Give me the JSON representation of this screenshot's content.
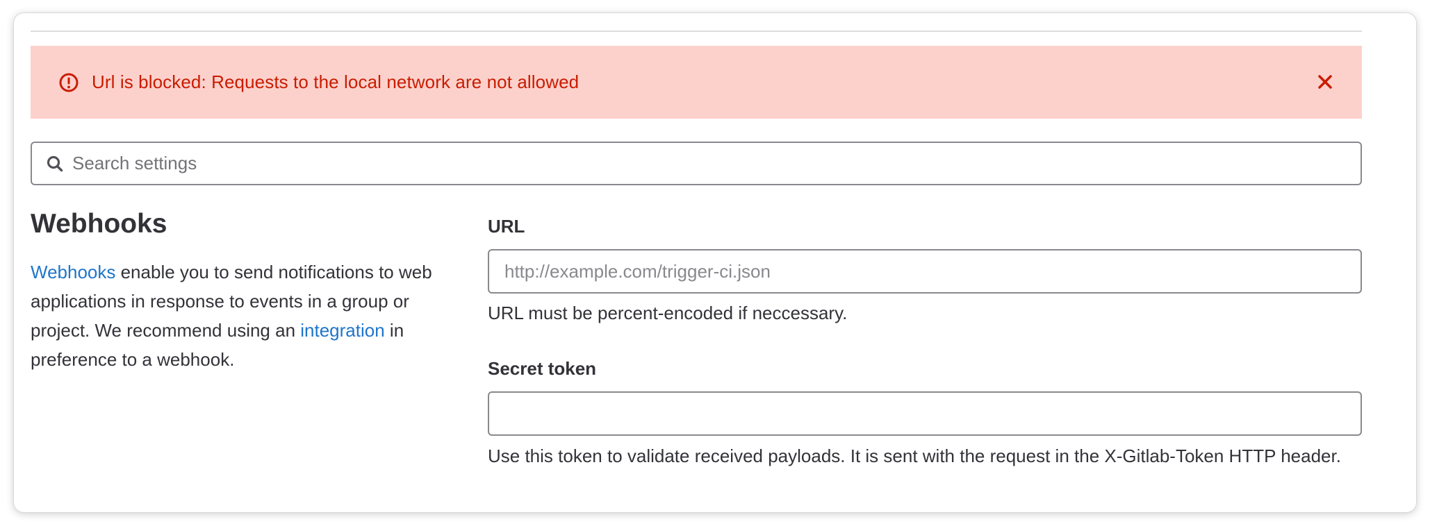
{
  "alert": {
    "icon": "error-icon",
    "message": "Url is blocked: Requests to the local network are not allowed",
    "close_icon": "close-icon",
    "color": "#c91c00",
    "background": "#fcd1cc"
  },
  "search": {
    "icon": "search-icon",
    "placeholder": "Search settings",
    "value": ""
  },
  "webhooks": {
    "title": "Webhooks",
    "description": {
      "link1": "Webhooks",
      "text1": " enable you to send notifications to web applications in response to events in a group or project. We recommend using an ",
      "link2": "integration",
      "text2": " in preference to a webhook."
    },
    "link_color": "#1f75cb"
  },
  "form": {
    "url": {
      "label": "URL",
      "placeholder": "http://example.com/trigger-ci.json",
      "value": "",
      "help": "URL must be percent-encoded if neccessary."
    },
    "secret_token": {
      "label": "Secret token",
      "value": "",
      "help": "Use this token to validate received payloads. It is sent with the request in the X-Gitlab-Token HTTP header."
    }
  }
}
